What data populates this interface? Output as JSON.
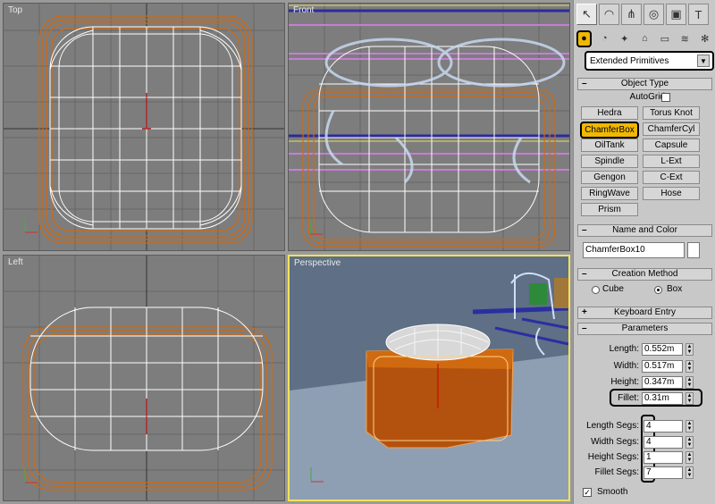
{
  "viewports": {
    "top": "Top",
    "front": "Front",
    "left": "Left",
    "perspective": "Perspective"
  },
  "command_panel": {
    "tabs": [
      "create-icon",
      "modify-icon",
      "hierarchy-icon",
      "motion-icon",
      "display-icon",
      "utilities-icon"
    ],
    "tab_glyphs": [
      "↖",
      "◠",
      "⋔",
      "◎",
      "▣",
      "T"
    ],
    "subcategories": [
      "geometry-icon",
      "shapes-icon",
      "lights-icon",
      "cameras-icon",
      "helpers-icon",
      "spacewarps-icon",
      "systems-icon"
    ],
    "sub_glyphs": [
      "●",
      "◔",
      "✦",
      "⌂",
      "▭",
      "≋",
      "✻"
    ],
    "category_dropdown": "Extended Primitives",
    "object_type": {
      "title": "Object Type",
      "autogrid_label": "AutoGrid",
      "buttons": [
        "Hedra",
        "Torus Knot",
        "ChamferBox",
        "ChamferCyl",
        "OilTank",
        "Capsule",
        "Spindle",
        "L-Ext",
        "Gengon",
        "C-Ext",
        "RingWave",
        "Hose",
        "Prism"
      ],
      "selected": "ChamferBox"
    },
    "name_and_color": {
      "title": "Name and Color",
      "name": "ChamferBox10",
      "color": "#ffffff"
    },
    "creation_method": {
      "title": "Creation Method",
      "options": [
        "Cube",
        "Box"
      ],
      "selected": "Box"
    },
    "keyboard_entry": {
      "title": "Keyboard Entry"
    },
    "parameters": {
      "title": "Parameters",
      "length_label": "Length:",
      "length": "0.552m",
      "width_label": "Width:",
      "width": "0.517m",
      "height_label": "Height:",
      "height": "0.347m",
      "fillet_label": "Fillet:",
      "fillet": "0.31m",
      "length_segs_label": "Length Segs:",
      "length_segs": "4",
      "width_segs_label": "Width Segs:",
      "width_segs": "4",
      "height_segs_label": "Height Segs:",
      "height_segs": "1",
      "fillet_segs_label": "Fillet Segs:",
      "fillet_segs": "7",
      "smooth_label": "Smooth",
      "smooth_checked": true
    }
  },
  "colors": {
    "selection_highlight": "#f0b800",
    "wire_orange": "#d06a10",
    "wire_white": "#ffffff",
    "viewport_bg": "#7d7d7d",
    "perspective_border": "#f2e25a"
  }
}
